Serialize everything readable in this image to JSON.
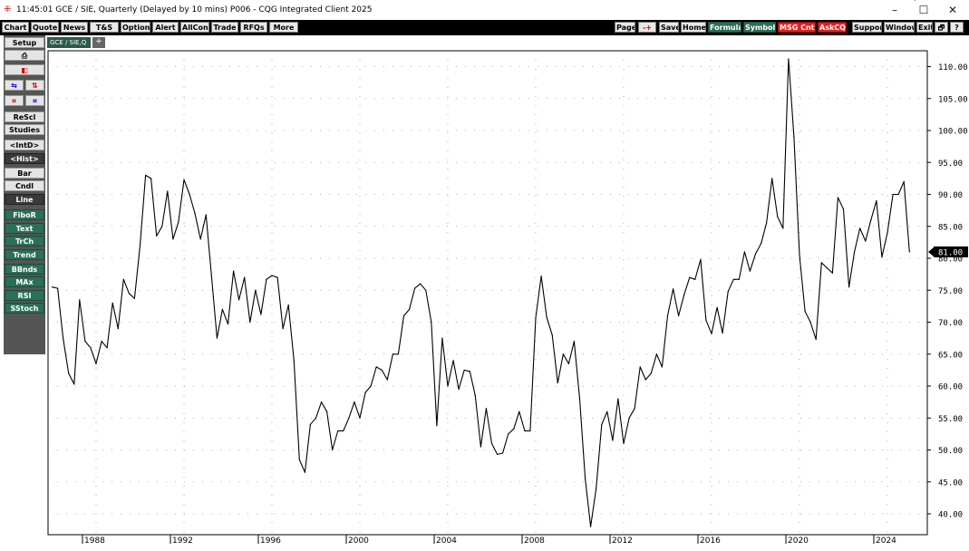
{
  "window": {
    "title": "11:45:01  GCE / SIE, Quarterly (Delayed by 10 mins)  P006 - CQG Integrated Client 2025",
    "minimize": "–",
    "maximize": "☐",
    "close": "✕"
  },
  "toolbar": {
    "left_buttons": [
      "Chart",
      "Quote",
      "News",
      "T&S",
      "Options",
      "Alert",
      "AllCon",
      "Trade",
      "RFQs",
      "More"
    ],
    "page_label": "Page",
    "arrow_label": "-+",
    "save_label": "Save",
    "home_label": "Home",
    "formula_label": "Formula",
    "symbols_label": "Symbols",
    "msg_label": "MSG Cntr",
    "askcqg_label": "AskCQG",
    "support_label": "Support",
    "window_label": "Window",
    "exit_label": "Exit",
    "restore_label": "🗗",
    "help_label": "?"
  },
  "sidebar": {
    "setup": "Setup",
    "print_icon": "printer-icon",
    "print_glyph": "⎙",
    "erase_glyph": "◧",
    "small_a": "⇆",
    "small_b": "⇅",
    "small_c": "⌗",
    "small_d": "⌗",
    "rescl": "ReScl",
    "studies": "Studies",
    "intd": "<IntD>",
    "hist": "<Hist>",
    "bar": "Bar",
    "cndl": "Cndl",
    "line": "Line",
    "fibor": "FiboR",
    "text": "Text",
    "trch": "TrCh",
    "trend": "Trend",
    "bbnds": "BBnds",
    "max": "MAx",
    "rsi": "RSI",
    "sstoch": "SStoch"
  },
  "tab": {
    "label": "GCE / SIE,Q",
    "add": "+"
  },
  "colors": {
    "toolbar_bg": "#000000",
    "teal_button": "#2c6e58",
    "red_button": "#e02020",
    "line": "#000000"
  },
  "chart_data": {
    "type": "line",
    "y_ticks": [
      "40.00",
      "45.00",
      "50.00",
      "55.00",
      "60.00",
      "65.00",
      "70.00",
      "75.00",
      "80.00",
      "85.00",
      "90.00",
      "95.00",
      "100.00",
      "105.00",
      "110.00"
    ],
    "ylim": [
      37.5,
      112.5
    ],
    "x_ticks": [
      "1988",
      "1992",
      "1996",
      "2000",
      "2004",
      "2008",
      "2012",
      "2016",
      "2020",
      "2024"
    ],
    "last_value_label": "81.00",
    "grid": true,
    "x": [
      1986.0,
      1986.25,
      1986.5,
      1986.75,
      1987.0,
      1987.25,
      1987.5,
      1987.75,
      1988.0,
      1988.25,
      1988.5,
      1988.75,
      1989.0,
      1989.25,
      1989.5,
      1989.75,
      1990.0,
      1990.25,
      1990.5,
      1990.75,
      1991.0,
      1991.25,
      1991.5,
      1991.75,
      1992.0,
      1992.25,
      1992.5,
      1992.75,
      1993.0,
      1993.25,
      1993.5,
      1993.75,
      1994.0,
      1994.25,
      1994.5,
      1994.75,
      1995.0,
      1995.25,
      1995.5,
      1995.75,
      1996.0,
      1996.25,
      1996.5,
      1996.75,
      1997.0,
      1997.25,
      1997.5,
      1997.75,
      1998.0,
      1998.25,
      1998.5,
      1998.75,
      1999.0,
      1999.25,
      1999.5,
      1999.75,
      2000.0,
      2000.25,
      2000.5,
      2000.75,
      2001.0,
      2001.25,
      2001.5,
      2001.75,
      2002.0,
      2002.25,
      2002.5,
      2002.75,
      2003.0,
      2003.25,
      2003.5,
      2003.75,
      2004.0,
      2004.25,
      2004.5,
      2004.75,
      2005.0,
      2005.25,
      2005.5,
      2005.75,
      2006.0,
      2006.25,
      2006.5,
      2006.75,
      2007.0,
      2007.25,
      2007.5,
      2007.75,
      2008.0,
      2008.25,
      2008.5,
      2008.75,
      2009.0,
      2009.25,
      2009.5,
      2009.75,
      2010.0,
      2010.25,
      2010.5,
      2010.75,
      2011.0,
      2011.25,
      2011.5,
      2011.75,
      2012.0,
      2012.25,
      2012.5,
      2012.75,
      2013.0,
      2013.25,
      2013.5,
      2013.75,
      2014.0,
      2014.25,
      2014.5,
      2014.75,
      2015.0,
      2015.25,
      2015.5,
      2015.75,
      2016.0,
      2016.25,
      2016.5,
      2016.75,
      2017.0,
      2017.25,
      2017.5,
      2017.75,
      2018.0,
      2018.25,
      2018.5,
      2018.75,
      2019.0,
      2019.25,
      2019.5,
      2019.75,
      2020.0,
      2020.25,
      2020.5,
      2020.75,
      2021.0,
      2021.25,
      2021.5,
      2021.75,
      2022.0,
      2022.25,
      2022.5,
      2022.75,
      2023.0,
      2023.25,
      2023.5,
      2023.75,
      2024.0,
      2024.25,
      2024.5,
      2024.75,
      2025.0,
      2025.25
    ],
    "values": [
      75.5,
      75.3,
      67.5,
      62.0,
      60.3,
      73.5,
      67.0,
      66.0,
      63.5,
      67.0,
      66.0,
      73.0,
      69.0,
      76.7,
      74.5,
      73.7,
      82.0,
      93.0,
      92.5,
      83.5,
      85.0,
      90.5,
      83.0,
      85.7,
      92.3,
      90.0,
      87.0,
      83.0,
      86.8,
      77.3,
      67.5,
      72.0,
      69.7,
      78.0,
      73.5,
      77.0,
      70.0,
      75.0,
      71.2,
      76.7,
      77.3,
      77.0,
      69.0,
      72.7,
      64.0,
      48.5,
      46.5,
      54.0,
      55.0,
      57.5,
      56.0,
      50.0,
      53.0,
      53.0,
      55.0,
      57.5,
      55.0,
      59.0,
      60.0,
      63.0,
      62.5,
      61.0,
      65.0,
      65.0,
      71.0,
      72.0,
      75.3,
      76.0,
      75.0,
      70.0,
      53.8,
      67.5,
      60.0,
      64.0,
      59.5,
      62.5,
      62.3,
      58.5,
      50.5,
      56.5,
      51.0,
      49.3,
      49.5,
      52.5,
      53.3,
      56.0,
      53.0,
      53.0,
      70.7,
      77.2,
      70.8,
      68.0,
      60.5,
      65.0,
      63.5,
      67.0,
      58.0,
      45.5,
      38.0,
      44.0,
      54.0,
      56.0,
      51.5,
      58.0,
      51.0,
      55.0,
      56.5,
      63.0,
      61.0,
      62.0,
      65.0,
      63.0,
      71.0,
      75.2,
      71.0,
      74.3,
      77.0,
      76.7,
      79.8,
      70.3,
      68.2,
      72.3,
      68.3,
      74.8,
      76.7,
      76.7,
      81.0,
      78.0,
      80.7,
      82.3,
      85.5,
      92.5,
      86.5,
      84.7,
      111.2,
      99.0,
      80.5,
      71.7,
      70.0,
      67.3,
      79.3,
      78.5,
      77.7,
      89.5,
      87.7,
      75.5,
      81.0,
      84.7,
      82.7,
      86.0,
      89.0,
      80.2,
      84.0,
      90.0,
      90.0,
      92.0,
      81.0
    ]
  }
}
